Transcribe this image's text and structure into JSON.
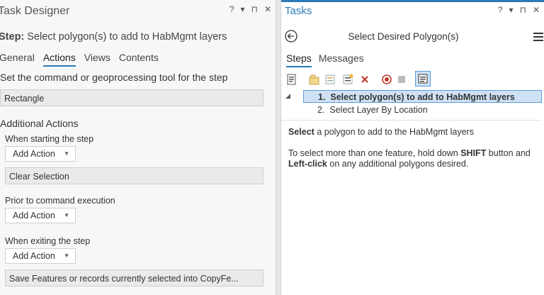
{
  "left": {
    "title": "Task Designer",
    "controls": [
      "?",
      "▾",
      "⊓",
      "✕"
    ],
    "step_label": "Step:",
    "step_name": "Select polygon(s) to add to HabMgmt layers",
    "tabs": [
      "General",
      "Actions",
      "Views",
      "Contents"
    ],
    "active_tab": "Actions",
    "command_heading": "Set the command or geoprocessing tool for the step",
    "command_value": "Rectangle",
    "additional_heading": "Additional Actions",
    "start_label": "When starting the step",
    "add_action_label": "Add Action",
    "clear_selection": "Clear Selection",
    "prior_label": "Prior to command execution",
    "exit_label": "When exiting the step",
    "save_features": "Save Features or records currently selected into CopyFe..."
  },
  "right": {
    "title": "Tasks",
    "controls": [
      "?",
      "▾",
      "⊓",
      "✕"
    ],
    "header_title": "Select Desired Polygon(s)",
    "tabs": [
      "Steps",
      "Messages"
    ],
    "active_tab": "Steps",
    "steps": [
      {
        "num": "1.",
        "label": "Select polygon(s) to add to HabMgmt layers",
        "selected": true
      },
      {
        "num": "2.",
        "label": "Select Layer By Location",
        "selected": false
      }
    ],
    "desc1_bold": "Select",
    "desc1_rest": " a polygon to add to the HabMgmt layers",
    "desc2_a": "To select more than one feature, hold down ",
    "desc2_b": "SHIFT",
    "desc2_c": " button and ",
    "desc2_d": "Left-click",
    "desc2_e": " on any additional polygons desired."
  },
  "colors": {
    "accent": "#2a7ab8",
    "selection": "#cfe2f5",
    "close_red": "#c0392b"
  }
}
